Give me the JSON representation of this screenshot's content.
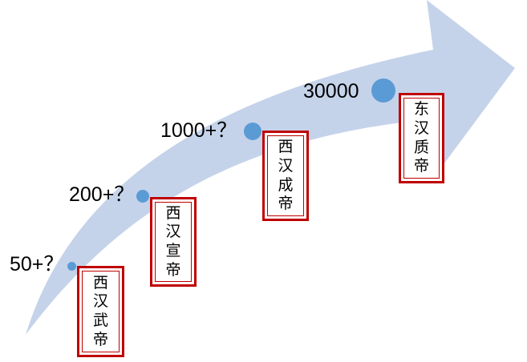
{
  "colors": {
    "arrow": "#c5d3ea",
    "dot": "#5b9bd5",
    "box_border": "#c00000"
  },
  "stages": [
    {
      "count": "50+？",
      "emperor": "西汉武帝"
    },
    {
      "count": "200+？",
      "emperor": "西汉宣帝"
    },
    {
      "count": "1000+？",
      "emperor": "西汉成帝"
    },
    {
      "count": "30000",
      "emperor": "东汉质帝"
    }
  ]
}
